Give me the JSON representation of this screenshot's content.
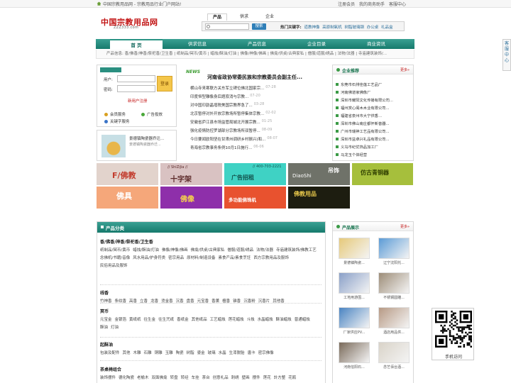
{
  "topbar": {
    "left_text": "中国宗教用品网 - 宗教用品行业门户网站!",
    "links": [
      "注册会员",
      "我的商务助手",
      "客服中心"
    ]
  },
  "logo": {
    "main": "中国宗教用品网",
    "sub": "ZZZ333.com"
  },
  "search": {
    "tabs": [
      "产品",
      "供求",
      "企业"
    ],
    "active_tab": "产品",
    "placeholder": "",
    "button": "搜索",
    "hot_label": "热门关键字:",
    "hot_words": [
      "道教神像",
      "高原制氧机",
      "树脂玻璃钢",
      "办公桌",
      "礼品盒"
    ]
  },
  "nav": {
    "items": [
      "首 页",
      "供求信息",
      "产品信息",
      "企业目录",
      "商业资讯"
    ],
    "active": "首 页",
    "sub_label": "产品信息:",
    "sub_links": "香/佛香/神香/祭祀香/卫生香 | 纸制品/冥币/黄币 | 蜡烛/酥油/灯油 | 佛像/神像/佛画 | 佛龛/供桌/古典家私 | 僧服/道服/绣品 | 法物/法器 | 寺庙建筑装饰/..."
  },
  "login": {
    "badge": "",
    "user_label": "用户:",
    "pass_label": "密码:",
    "login_button": "登录",
    "register_link": "新用户注册",
    "services": [
      "会员服务",
      "广告投放",
      "关键字服务"
    ]
  },
  "ad": {
    "title": "景德镇陶瓷器乔迁...",
    "desc": "景德镇陶瓷器乔迁..."
  },
  "news": {
    "tag": "NEWS",
    "headline": "河南省政协常委民族和宗教委员会副主任...",
    "items": [
      {
        "title": "横山寺来寒联方关东军立碑位佛北国家宗...",
        "date": "07-28"
      },
      {
        "title": "印度恒型雕像身后题寂消与宗教...",
        "date": "07-20"
      },
      {
        "title": "对中国印韵晶增税美国宗教界急了...",
        "date": "03-28"
      },
      {
        "title": "北京暂停对外开放宗教场所暂停集体宗教...",
        "date": "02-02"
      },
      {
        "title": "安徽省庐江县市场监管局城北开展宗教...",
        "date": "01-25"
      },
      {
        "title": "强化疫情防控罗湖部分宗教场所双暂停...",
        "date": "08-09"
      },
      {
        "title": "今日要闻欧阳坚在甘肃州调研乡村振兴(和...",
        "date": "08-07"
      },
      {
        "title": "青海省宗教事务条例10月1日施行...",
        "date": "06-06"
      }
    ]
  },
  "enterprises": {
    "title": "企业推荐",
    "more": "更多»",
    "items": [
      "东莞市石排佳莲工艺品厂",
      "河南佛道家佛像厂",
      "深圳市耀阳文化传播有限公司...",
      "福州赏心阁木木业有限公司...",
      "福建省泉州市大宁供香...",
      "深圳市佛山南庄都怀新菩器...",
      "广州市瑞神工艺品有限公司...",
      "深圳市益卓兴礼品有限公司...",
      "义乌市纪优饰品加工厂",
      "马龙玉个体经营"
    ]
  },
  "banners": [
    {
      "title": "F/佛教",
      "sub": "",
      "color": "#e2d3cc",
      "text_color": "#c23b2c"
    },
    {
      "title": "十字架",
      "sub": "// ShiZiJia //",
      "color": "#d9c2c2",
      "text_color": "#5c2a2a"
    },
    {
      "title": "广告招租",
      "sub": "// 400-703-2221",
      "color": "#3fd2c4",
      "text_color": "#13524c"
    },
    {
      "title": "吊饰",
      "sub": "DiaoShi",
      "color": "#6f7269",
      "text_color": "#ffffff"
    },
    {
      "title": "仿古青铜器",
      "sub": "",
      "color": "#a6bf3c",
      "text_color": "#2f3f00"
    },
    {
      "title": "佛具",
      "sub": "",
      "color": "#f5a77a",
      "text_color": "#ffffff"
    },
    {
      "title": "佛像",
      "sub": "",
      "color": "#8e2faa",
      "text_color": "#f7d54a"
    },
    {
      "title": "多功能佛珠机",
      "sub": "",
      "color": "#e8522f",
      "text_color": "#ffffff"
    },
    {
      "title": "佛教用品",
      "sub": "",
      "color": "#1d1d10",
      "text_color": "#e6c64a"
    }
  ],
  "categories": {
    "title": "产品分类",
    "groups": [
      {
        "title": "香/佛香/神香/祭祀香/卫生香",
        "items": [
          "纸制品/冥币/黄币",
          "蜡烛/酥油/灯油",
          "佛像/神像/佛画",
          "佛龛/供桌/古典家私",
          "僧服/道服/绣品",
          "法物/法器",
          "寺庙建筑装饰/佛教工艺",
          "念佛机/书籍/音像",
          "风水用品/护身符类",
          "密宗用品",
          "原材料/制造设备",
          "素食产品/素食烹饪",
          "西方宗教用品及服饰",
          "民俗用品及服饰"
        ]
      },
      {
        "title": "线香",
        "items": [
          "竹神香",
          "条纹香",
          "高香",
          "立香",
          "龙香",
          "烫金香",
          "沉香",
          "盘香",
          "元宝香",
          "香薰",
          "檀香",
          "锥香",
          "沉香粉",
          "沉香片",
          "其他香"
        ]
      },
      {
        "title": "冥币",
        "items": [
          "元宝金",
          "金银箔",
          "黄纸纸",
          "往生金",
          "往生咒纸",
          "香纸金",
          "其他纸品",
          "工艺蜡烛",
          "莲花蜡烛",
          "斗烛",
          "水晶蜡烛",
          "酥油蜡烛",
          "普通蜡烛",
          "酥油",
          "灯油"
        ]
      },
      {
        "title": "起酥油",
        "items": [
          "包装及配件",
          "其他",
          "木雕",
          "石雕",
          "铜雕",
          "玉雕",
          "陶瓷",
          "树脂",
          "鎏金",
          "玻璃",
          "水晶",
          "生漆脱胎",
          "唐卡",
          "密宗佛像"
        ]
      },
      {
        "title": "茶桌椅组合",
        "items": [
          "装饰摆件",
          "德化陶瓷",
          "老榆木",
          "双面佛龛",
          "转盘",
          "转经",
          "车挂",
          "茶台",
          "创意礼品",
          "刺绣",
          "壁画",
          "摆件",
          "莲花",
          "計方整",
          "花瓶"
        ]
      }
    ]
  },
  "products": {
    "title": "产品展示",
    "more": "更多»",
    "items": [
      {
        "caption": "景德镇陶瓷...",
        "color": "#e6c97a"
      },
      {
        "caption": "辽宁沈阳托...",
        "color": "#5b9bd6"
      },
      {
        "caption": "工地用游围...",
        "color": "#8aa0c8"
      },
      {
        "caption": "不锈钢圆雕...",
        "color": "#9d8d78"
      },
      {
        "caption": "厂家供应PV...",
        "color": "#4a84c2"
      },
      {
        "caption": "酒店用品供...",
        "color": "#b79a85"
      },
      {
        "caption": "河南信阳石...",
        "color": "#7a6a5a"
      },
      {
        "caption": "念艺佰台酒...",
        "color": "#d9d3c8"
      }
    ]
  },
  "side_service": "客服中心",
  "qr_caption": "手机访问"
}
